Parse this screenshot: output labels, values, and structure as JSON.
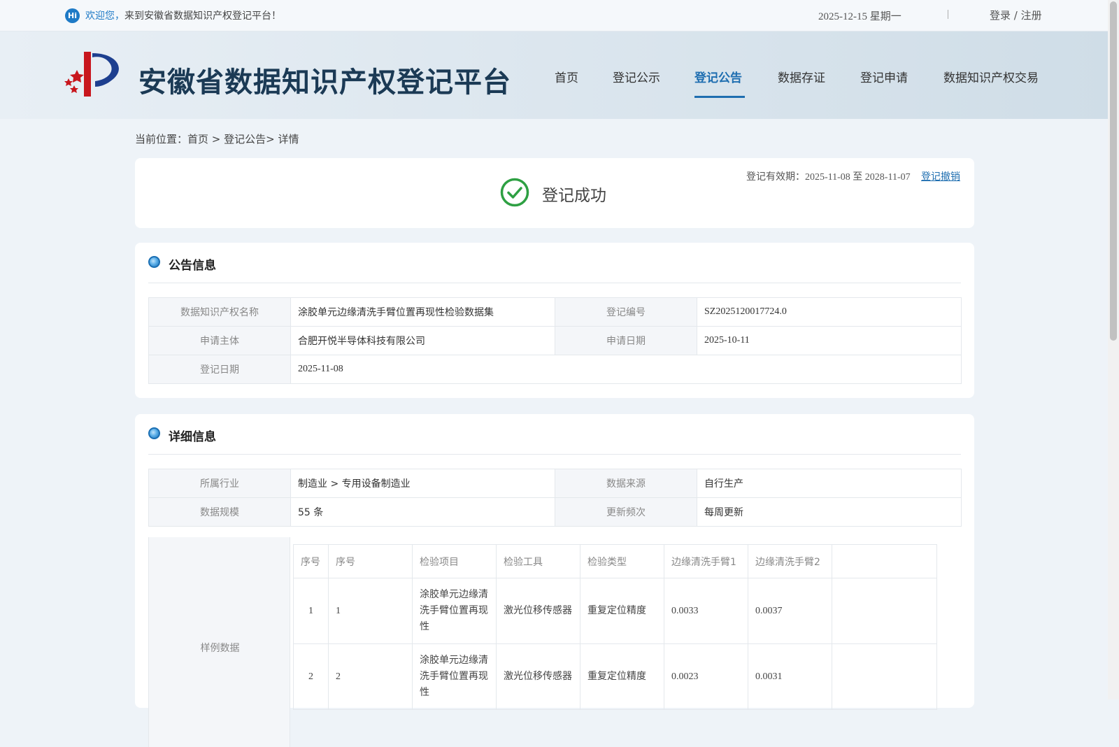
{
  "topbar": {
    "hi": "Hi",
    "welcome_prefix": "欢迎您，",
    "welcome_suffix": "来到安徽省数据知识产权登记平台！",
    "date": "2025-12-15 星期一",
    "separator": "|",
    "login": "登录 / 注册"
  },
  "header": {
    "title": "安徽省数据知识产权登记平台",
    "nav": [
      "首页",
      "登记公示",
      "登记公告",
      "数据存证",
      "登记申请",
      "数据知识产权交易"
    ],
    "active_nav": "登记公告"
  },
  "breadcrumb": {
    "label": "当前位置：",
    "path": "首页 > 登记公告> 详情"
  },
  "status": {
    "text": "登记成功",
    "validity_label": "登记有效期：",
    "validity_value": "2025-11-08 至 2028-11-07",
    "revoke": "登记撤销"
  },
  "announcement": {
    "title": "公告信息",
    "name_label": "数据知识产权名称",
    "name_value": "涂胶单元边缘清洗手臂位置再现性检验数据集",
    "regno_label": "登记编号",
    "regno_value": "SZ2025120017724.0",
    "applicant_label": "申请主体",
    "applicant_value": "合肥开悦半导体科技有限公司",
    "apply_date_label": "申请日期",
    "apply_date_value": "2025-10-11",
    "reg_date_label": "登记日期",
    "reg_date_value": "2025-11-08"
  },
  "details": {
    "title": "详细信息",
    "industry_label": "所属行业",
    "industry_value": "制造业 > 专用设备制造业",
    "source_label": "数据来源",
    "source_value": "自行生产",
    "scale_label": "数据规模",
    "scale_value": "55 条",
    "frequency_label": "更新频次",
    "frequency_value": "每周更新",
    "sample_label": "样例数据",
    "sample_headers": [
      "序号",
      "序号",
      "检验项目",
      "检验工具",
      "检验类型",
      "边缘清洗手臂1",
      "边缘清洗手臂2"
    ],
    "sample_rows": [
      [
        "1",
        "1",
        "涂胶单元边缘清洗手臂位置再现性",
        "激光位移传感器",
        "重复定位精度",
        "0.0033",
        "0.0037"
      ],
      [
        "2",
        "2",
        "涂胶单元边缘清洗手臂位置再现性",
        "激光位移传感器",
        "重复定位精度",
        "0.0023",
        "0.0031"
      ]
    ]
  },
  "colors": {
    "accent": "#1e6eb0",
    "success": "#2ea043",
    "background": "#eef3f8"
  }
}
